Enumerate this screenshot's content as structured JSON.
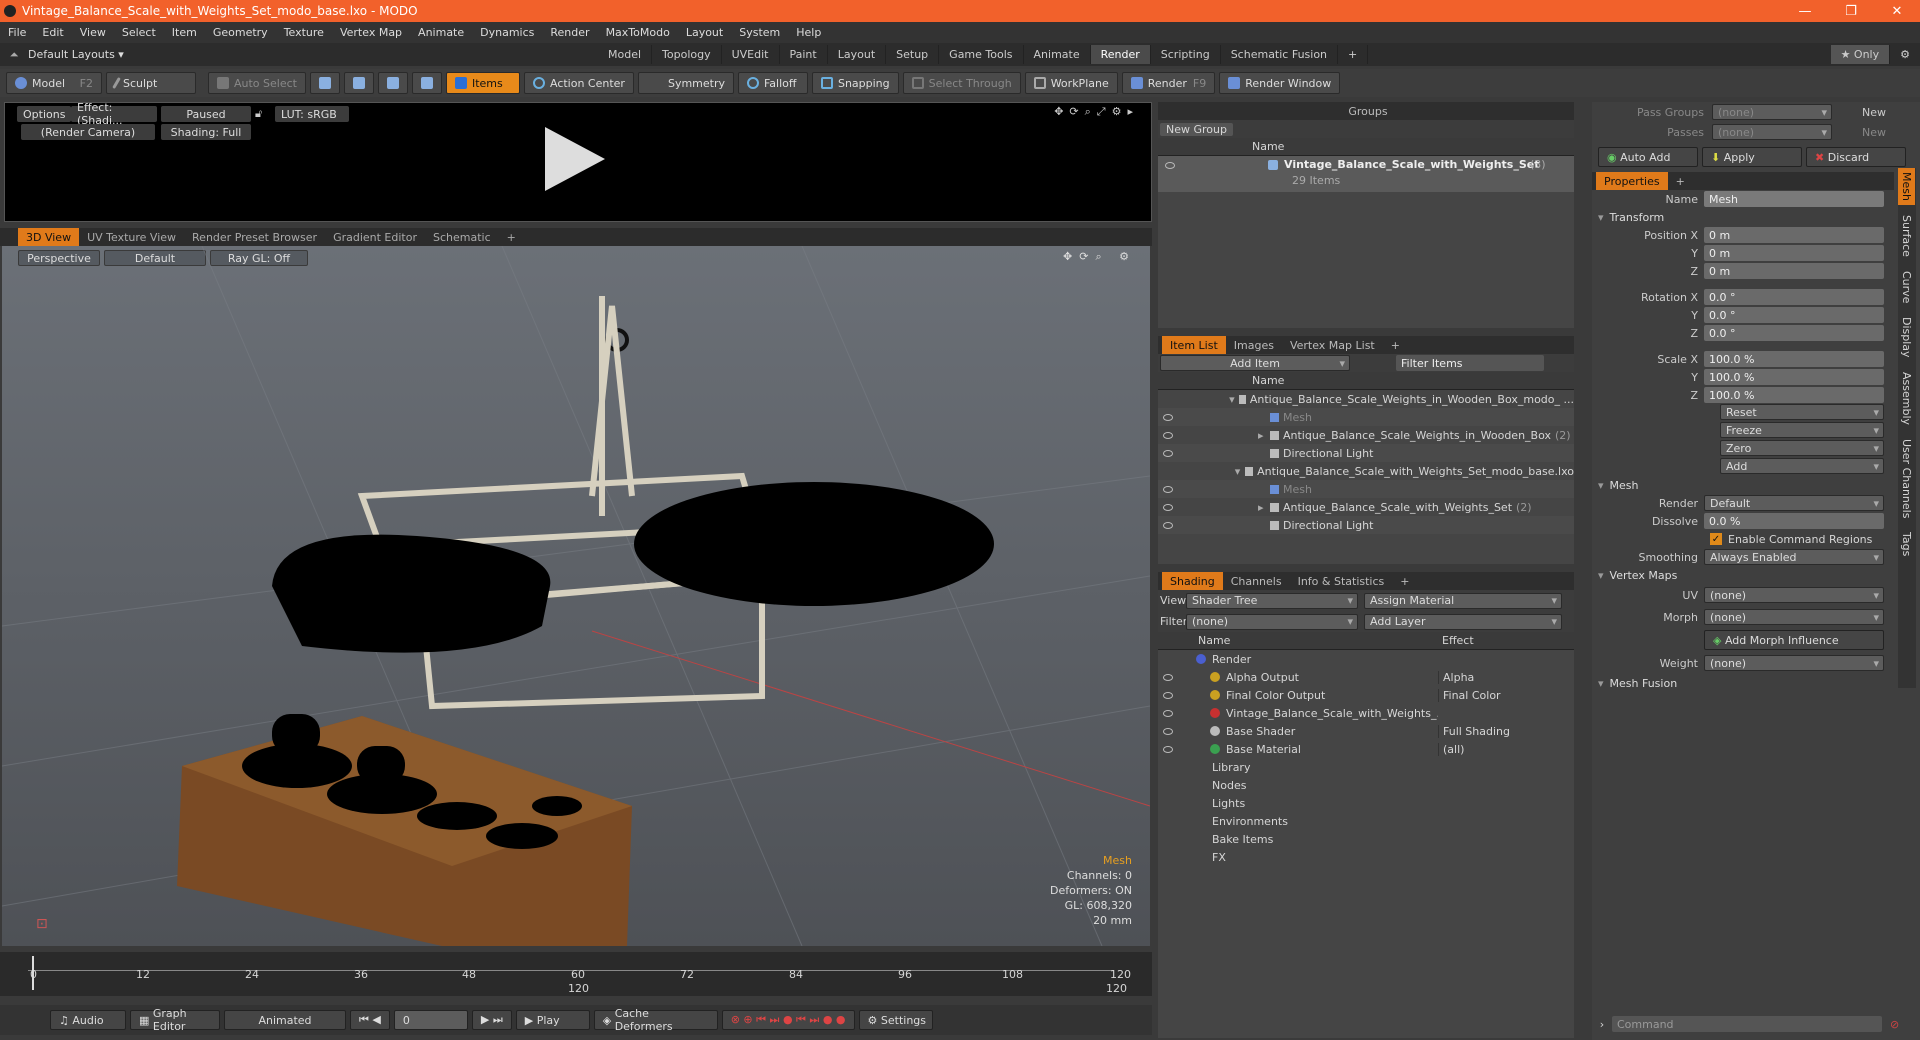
{
  "window": {
    "title": "Vintage_Balance_Scale_with_Weights_Set_modo_base.lxo - MODO",
    "min": "—",
    "max": "❐",
    "close": "✕"
  },
  "menu": [
    "File",
    "Edit",
    "View",
    "Select",
    "Item",
    "Geometry",
    "Texture",
    "Vertex Map",
    "Animate",
    "Dynamics",
    "Render",
    "MaxToModo",
    "Layout",
    "System",
    "Help"
  ],
  "layout": {
    "preset": "Default Layouts ▾",
    "tabs": [
      "Model",
      "Topology",
      "UVEdit",
      "Paint",
      "Layout",
      "Setup",
      "Game Tools",
      "Animate",
      "Render",
      "Scripting",
      "Schematic Fusion"
    ],
    "active": "Render",
    "plus": "+",
    "only": "★ Only"
  },
  "toolbar": {
    "model": "Model",
    "model_key": "F2",
    "sculpt": "Sculpt",
    "auto_select": "Auto Select",
    "items": "Items",
    "action_center": "Action Center",
    "symmetry": "Symmetry",
    "falloff": "Falloff",
    "snapping": "Snapping",
    "select_through": "Select Through",
    "workplane": "WorkPlane",
    "render": "Render",
    "render_key": "F9",
    "render_window": "Render Window"
  },
  "preview": {
    "options": "Options",
    "effect": "Effect: (Shadi...",
    "paused": "Paused",
    "lut": "LUT: sRGB",
    "camera": "(Render Camera)",
    "shading": "Shading: Full"
  },
  "vptabs": [
    "3D View",
    "UV Texture View",
    "Render Preset Browser",
    "Gradient Editor",
    "Schematic"
  ],
  "viewport": {
    "perspective": "Perspective",
    "default": "Default",
    "raygl": "Ray GL: Off",
    "hud": {
      "mesh": "Mesh",
      "channels": "Channels: 0",
      "deformers": "Deformers: ON",
      "gl": "GL: 608,320",
      "mm": "20 mm"
    }
  },
  "timeline": {
    "ticks": [
      "0",
      "12",
      "24",
      "36",
      "48",
      "60",
      "72",
      "84",
      "96",
      "108",
      "120"
    ],
    "sub_mid": "120",
    "sub_end": "120"
  },
  "bottom": {
    "audio": "Audio",
    "graph": "Graph Editor",
    "animated": "Animated",
    "frame": "0",
    "play": "Play",
    "cache": "Cache Deformers",
    "settings": "Settings"
  },
  "groups": {
    "title": "Groups",
    "new_group": "New Group",
    "col_name": "Name",
    "item": "Vintage_Balance_Scale_with_Weights_Set",
    "count": "(3)",
    "sub": "29 Items"
  },
  "itemlist": {
    "tabs": [
      "Item List",
      "Images",
      "Vertex Map List"
    ],
    "add_item": "Add Item",
    "filter": "Filter Items",
    "col_name": "Name",
    "rows": [
      {
        "indent": 0,
        "arrow": "▾",
        "text": "Antique_Balance_Scale_Weights_in_Wooden_Box_modo_ ...",
        "dim": false
      },
      {
        "indent": 1,
        "arrow": "",
        "text": "Mesh",
        "dim": true
      },
      {
        "indent": 1,
        "arrow": "▸",
        "text": "Antique_Balance_Scale_Weights_in_Wooden_Box",
        "count": "(2)",
        "dim": false
      },
      {
        "indent": 1,
        "arrow": "",
        "text": "Directional Light",
        "dim": false
      },
      {
        "indent": 0,
        "arrow": "▾",
        "text": "Antique_Balance_Scale_with_Weights_Set_modo_base.lxo",
        "dim": false
      },
      {
        "indent": 1,
        "arrow": "",
        "text": "Mesh",
        "dim": true
      },
      {
        "indent": 1,
        "arrow": "▸",
        "text": "Antique_Balance_Scale_with_Weights_Set",
        "count": "(2)",
        "dim": false
      },
      {
        "indent": 1,
        "arrow": "",
        "text": "Directional Light",
        "dim": false
      }
    ]
  },
  "shading": {
    "tabs": [
      "Shading",
      "Channels",
      "Info & Statistics"
    ],
    "view_label": "View",
    "view": "Shader Tree",
    "assign": "Assign Material",
    "filter_label": "Filter",
    "filter": "(none)",
    "add_layer": "Add Layer",
    "col_name": "Name",
    "col_effect": "Effect",
    "rows": [
      {
        "indent": 0,
        "text": "Render",
        "effect": "",
        "color": "#4a5fd0"
      },
      {
        "indent": 1,
        "text": "Alpha Output",
        "effect": "Alpha",
        "color": "#c9a021"
      },
      {
        "indent": 1,
        "text": "Final Color Output",
        "effect": "Final Color",
        "color": "#c9a021"
      },
      {
        "indent": 1,
        "text": "Vintage_Balance_Scale_with_Weights_...",
        "effect": "",
        "color": "#c83030"
      },
      {
        "indent": 1,
        "text": "Base Shader",
        "effect": "Full Shading",
        "color": "#bbbbbb"
      },
      {
        "indent": 1,
        "text": "Base Material",
        "effect": "(all)",
        "color": "#3aa050"
      },
      {
        "indent": 0,
        "text": "Library",
        "effect": "",
        "color": ""
      },
      {
        "indent": 0,
        "text": "Nodes",
        "effect": "",
        "color": ""
      },
      {
        "indent": 0,
        "text": "Lights",
        "effect": "",
        "color": ""
      },
      {
        "indent": 0,
        "text": "Environments",
        "effect": "",
        "color": ""
      },
      {
        "indent": 0,
        "text": "Bake Items",
        "effect": "",
        "color": ""
      },
      {
        "indent": 0,
        "text": "FX",
        "effect": "",
        "color": ""
      }
    ]
  },
  "props": {
    "pass_groups": "Pass Groups",
    "passes": "Passes",
    "none": "(none)",
    "new": "New",
    "auto_add": "Auto Add",
    "apply": "Apply",
    "discard": "Discard",
    "tab": "Properties",
    "name_label": "Name",
    "name": "Mesh",
    "transform": "Transform",
    "pos_x": "Position X",
    "y": "Y",
    "z": "Z",
    "rot_x": "Rotation X",
    "scale_x": "Scale X",
    "pos_val": "0 m",
    "rot_val": "0.0 °",
    "scale_val": "100.0 %",
    "reset": "Reset",
    "freeze": "Freeze",
    "zero": "Zero",
    "add": "Add",
    "mesh": "Mesh",
    "render_label": "Render",
    "render_val": "Default",
    "dissolve_label": "Dissolve",
    "dissolve_val": "0.0 %",
    "enable_cmd": "Enable Command Regions",
    "smoothing_label": "Smoothing",
    "smoothing_val": "Always Enabled",
    "vertex_maps": "Vertex Maps",
    "uv_label": "UV",
    "morph_label": "Morph",
    "add_morph": "Add Morph Influence",
    "weight_label": "Weight",
    "mesh_fusion": "Mesh Fusion",
    "sidetabs": [
      "Mesh",
      "Surface",
      "Curve",
      "Display",
      "Assembly",
      "User Channels",
      "Tags"
    ],
    "command": "Command"
  }
}
